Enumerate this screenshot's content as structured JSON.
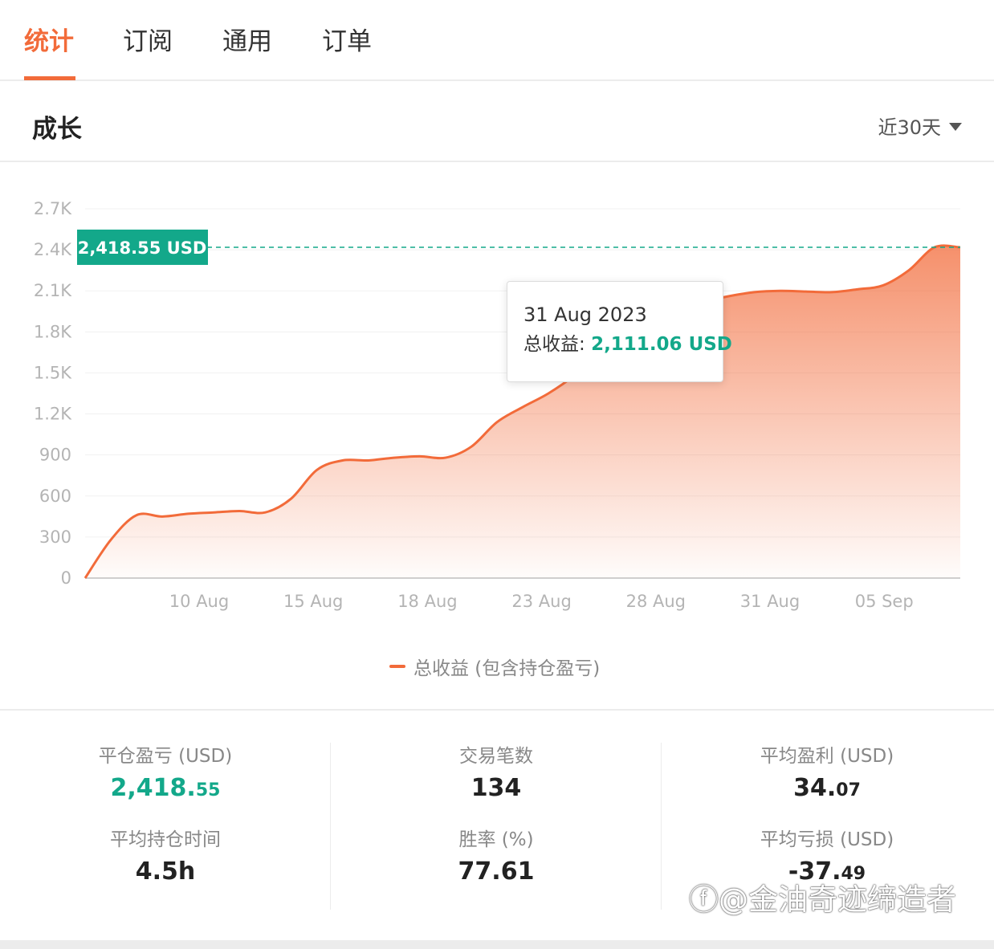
{
  "tabs": [
    {
      "label": "统计",
      "active": true
    },
    {
      "label": "订阅",
      "active": false
    },
    {
      "label": "通用",
      "active": false
    },
    {
      "label": "订单",
      "active": false
    }
  ],
  "section": {
    "title": "成长",
    "range_label": "近30天"
  },
  "chart_data": {
    "type": "area",
    "y_ticks": [
      "0",
      "300",
      "600",
      "900",
      "1.2K",
      "1.5K",
      "1.8K",
      "2.1K",
      "2.4K",
      "2.7K"
    ],
    "ylim": [
      0,
      2700
    ],
    "x_tick_labels": [
      "10 Aug",
      "15 Aug",
      "18 Aug",
      "23 Aug",
      "28 Aug",
      "31 Aug",
      "05 Sep"
    ],
    "series": [
      {
        "name": "总收益 (包含持仓盈亏)",
        "color": "#f26b3a",
        "values": [
          0,
          280,
          460,
          450,
          470,
          480,
          490,
          480,
          580,
          790,
          860,
          860,
          880,
          890,
          880,
          960,
          1140,
          1250,
          1350,
          1480,
          1650,
          1780,
          1880,
          1960,
          2020,
          2060,
          2090,
          2100,
          2095,
          2090,
          2111,
          2140,
          2250,
          2418,
          2418
        ]
      }
    ],
    "marker": {
      "label": "2,418.55 USD",
      "value": 2418.55,
      "color": "#13a88a"
    },
    "tooltip": {
      "date": "31 Aug 2023",
      "label": "总收益:",
      "value": "2,111.06 USD"
    },
    "grid": true
  },
  "stats": {
    "realized_pnl": {
      "label": "平仓盈亏 (USD)",
      "int": "2,418.",
      "dec": "55"
    },
    "avg_hold": {
      "label": "平均持仓时间",
      "value": "4.5h"
    },
    "trades": {
      "label": "交易笔数",
      "value": "134"
    },
    "win_rate": {
      "label": "胜率 (%)",
      "value": "77.61"
    },
    "avg_profit": {
      "label": "平均盈利 (USD)",
      "int": "34.",
      "dec": "07"
    },
    "avg_loss": {
      "label": "平均亏损 (USD)",
      "int": "-37.",
      "dec": "49"
    }
  },
  "watermark": "@金油奇迹缔造者",
  "colors": {
    "accent": "#f26b3a",
    "positive": "#13a88a"
  }
}
